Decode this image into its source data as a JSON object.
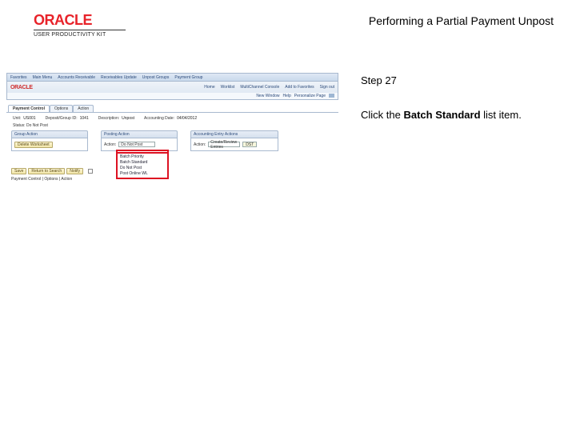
{
  "header": {
    "logo_text": "ORACLE",
    "logo_sub": "USER PRODUCTIVITY KIT",
    "page_title": "Performing a Partial Payment Unpost"
  },
  "instructions": {
    "step_label": "Step 27",
    "line_prefix": "Click the ",
    "bold_text": "Batch Standard",
    "line_suffix": " list item."
  },
  "app": {
    "breadcrumbs": [
      "Favorites",
      "Main Menu",
      "Accounts Receivable",
      "Receivables Update",
      "Unpost Groups",
      "Payment Group"
    ],
    "logo": "ORACLE",
    "top_links": [
      "Home",
      "Worklist",
      "MultiChannel Console",
      "Add to Favorites",
      "Sign out"
    ],
    "util": [
      "New Window",
      "Help",
      "Personalize Page"
    ],
    "tabs": [
      "Payment Control",
      "Options",
      "Action"
    ],
    "fields": {
      "unit_label": "Unit:",
      "unit_val": "US001",
      "deposit_label": "Deposit/Group ID:",
      "deposit_val": "1041",
      "desc_label": "Description:",
      "desc_val": "Unpost",
      "acct_label": "Accounting Date:",
      "acct_val": "04/04/2012"
    },
    "sub": {
      "label": "Status:",
      "val": "Do Not Post"
    },
    "panel1": {
      "title": "Group Action",
      "button": "Delete Worksheet"
    },
    "panel2": {
      "title": "Posting Action",
      "action_label": "Action:",
      "action_val": "Do Not Post"
    },
    "panel3": {
      "title": "Accounting Entry Actions",
      "ent_label": "Action:",
      "ent_btn": "Create/Review Entries",
      "dst_btn": "DST"
    },
    "dropdown_options": [
      "Batch Priority",
      "Batch Standard",
      "Do Not Post",
      "Post Online WL"
    ],
    "bottom": {
      "save": "Save",
      "ret": "Return to Search",
      "notify": "Notify",
      "tabs_footer": "Payment Control | Options | Action"
    }
  }
}
